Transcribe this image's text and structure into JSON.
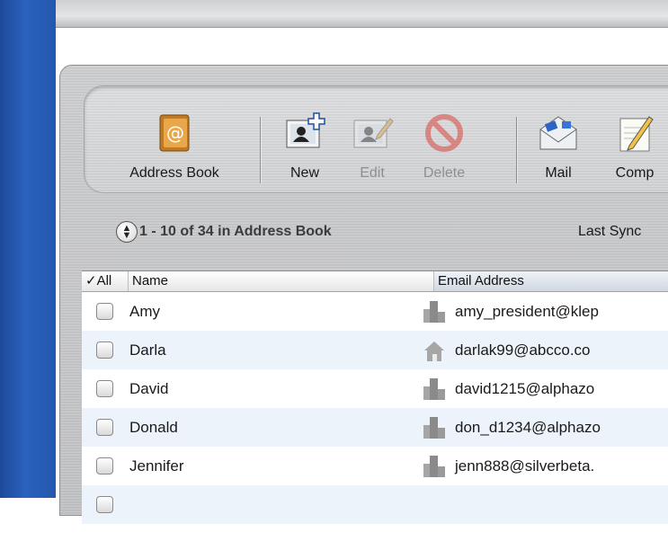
{
  "toolbar": {
    "buttons": [
      {
        "label": "Address Book",
        "icon": "address-book-icon",
        "enabled": true
      },
      {
        "label": "New",
        "icon": "new-contact-icon",
        "enabled": true
      },
      {
        "label": "Edit",
        "icon": "edit-contact-icon",
        "enabled": false
      },
      {
        "label": "Delete",
        "icon": "delete-icon",
        "enabled": false
      },
      {
        "label": "Mail",
        "icon": "mail-icon",
        "enabled": true
      },
      {
        "label": "Comp",
        "icon": "compose-icon",
        "enabled": true
      }
    ]
  },
  "status": {
    "range": "1 - 10 of 34 in Address Book",
    "last_sync": "Last Sync"
  },
  "table": {
    "headers": {
      "all": "✓All",
      "name": "Name",
      "email": "Email Address"
    },
    "rows": [
      {
        "name": "Amy",
        "type": "work",
        "email": "amy_president@klep"
      },
      {
        "name": "Darla",
        "type": "home",
        "email": "darlak99@abcco.co"
      },
      {
        "name": "David",
        "type": "work",
        "email": "david1215@alphazo"
      },
      {
        "name": "Donald",
        "type": "work",
        "email": "don_d1234@alphazo"
      },
      {
        "name": "Jennifer",
        "type": "work",
        "email": "jenn888@silverbeta."
      }
    ]
  },
  "colors": {
    "desktop": "#2458ae",
    "row_alt": "#edf3fb"
  }
}
